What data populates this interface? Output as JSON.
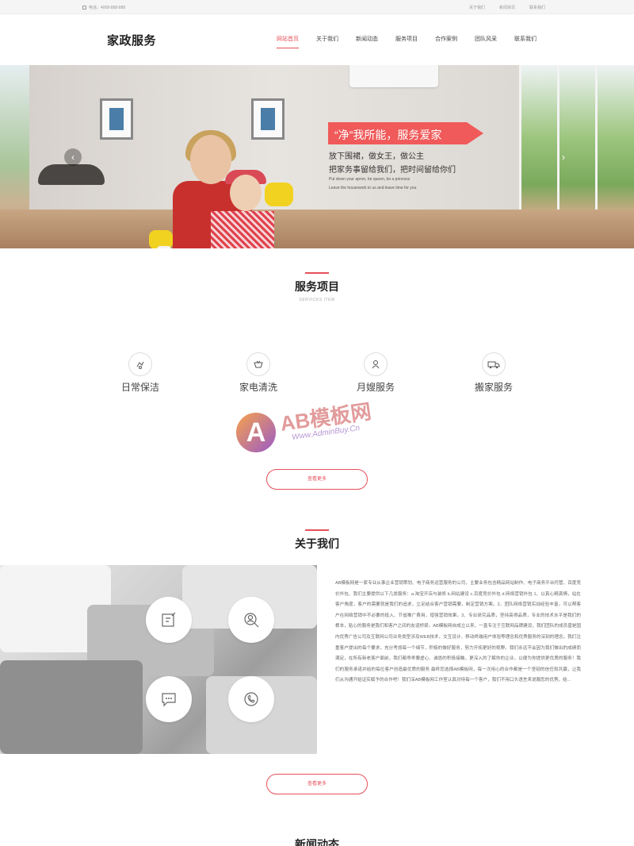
{
  "topbar": {
    "phone": "电话：4008-888-888",
    "links": [
      "关于我们",
      "新闻资讯",
      "联系我们"
    ]
  },
  "header": {
    "logo": "家政服务",
    "nav": [
      "网站首页",
      "关于我们",
      "新闻动态",
      "服务项目",
      "合作案例",
      "团队风采",
      "联系我们"
    ],
    "active_index": 0
  },
  "banner": {
    "slogan": "“净”我所能，服务爱家",
    "line1": "放下围裙，做女王，做公主",
    "line2": "把家务事留给我们，把时间留给你们",
    "line3": "Put down your apron, be queen, be a princess",
    "line4": "Leave the housework to us and leave time for you",
    "prev_arrow": "‹",
    "next_arrow": "›"
  },
  "services": {
    "title": "服务项目",
    "subtitle": "SERVICES ITEM",
    "items": [
      {
        "label": "日常保洁",
        "icon": "cleaning-icon"
      },
      {
        "label": "家电清洗",
        "icon": "appliance-icon"
      },
      {
        "label": "月嫂服务",
        "icon": "nanny-icon"
      },
      {
        "label": "搬家服务",
        "icon": "moving-truck-icon"
      }
    ],
    "more": "查看更多"
  },
  "watermark": {
    "letter": "A",
    "title": "AB模板网",
    "url": "Www.AdminBuy.Cn"
  },
  "about": {
    "title": "关于我们",
    "text": "AB模板网是一家专业从事企业营销策划、电子商务运营服务的公司，主要业务包含精品网站制作、电子商务平台托管、百度竞价外包、我们主要提供以下几类服务：a.淘宝开店与装修 b.网站建设 c.百度竞价外包 d.网络营销外包 1、以真心精真情，站在客户角度，客户的需要就是我们的追求，立足结合客户营销需要，制定营销方案。2、团队网络营销实战经验丰富，可以帮客户在网络营销中不必要的投入、节省推广费用，增强营销效果。3、专业研究品质，坚持高得品质，专业的技术水平是我们的根本，贴心的服务是我们和客户之间的友谊桥梁。AB模板网自成立以来，一直专注于互联网品牌建设，我们团队的成员曾是国内优秀广告公司及互联网公司业务类型涉及WEB技术、交互设计、移动终端用户体验等理念和优秀服务的深刻的理念。我们注重客户提出的每个要求，充分考虑每一个细节，积极的做好服务，努力开拓更好的视野。我们永远不会因为我们做出的成绩而满足，在所有新老客户面前，我们都乖乖要虚心、诚恳的积极接触，更深入的了解你的企业，以便为你提供更优质的服务！我们的服务承诺并给的每位客户创造最优质的服务 最终您选择AB模板网，每一次用心的合作都是一个坚韧的信任和共赢，让我们从沟通开始证实赋予的合作吧！我们深AB模板网工作室认真对待每一个客户，我们不用口头语言来说服您的优秀，给...",
    "icons": [
      "edit-icon",
      "user-search-icon",
      "chat-icon",
      "phone-icon"
    ],
    "more": "查看更多"
  },
  "news": {
    "title": "新闻动态"
  }
}
